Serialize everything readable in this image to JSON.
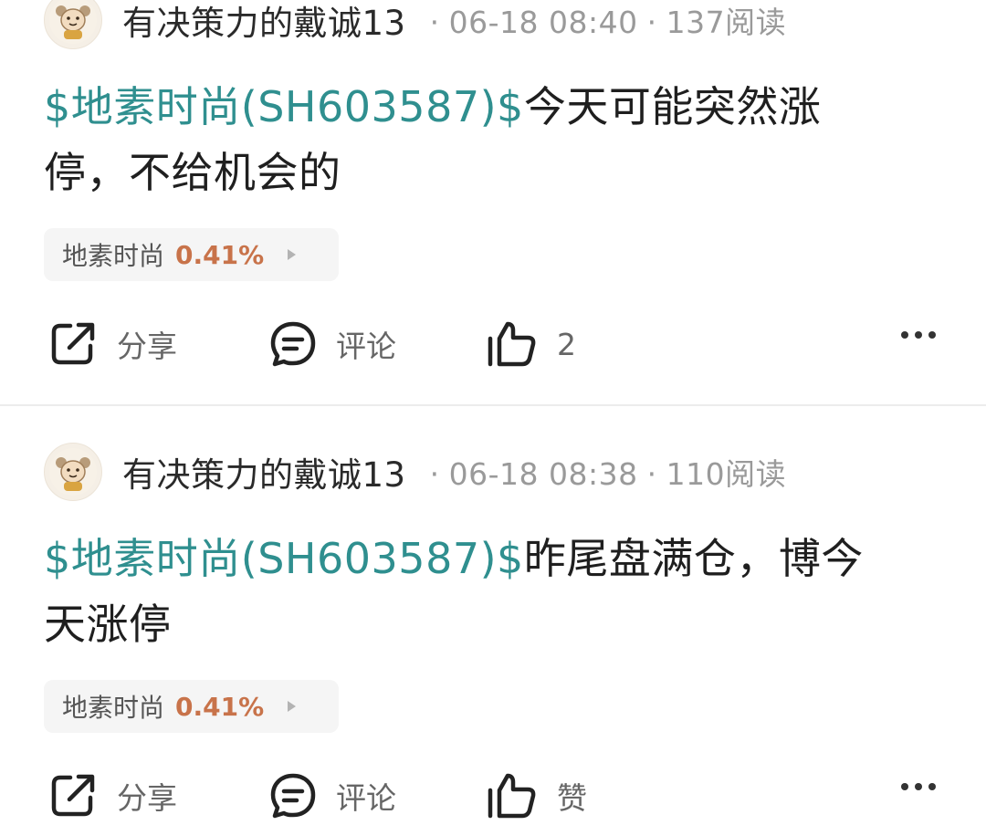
{
  "posts": [
    {
      "author": "有决策力的戴诚13",
      "time": "06-18 08:40",
      "reads": "137阅读",
      "stock_tag": "$地素时尚(SH603587)$",
      "body_line1": "今天可能突然涨",
      "body_line2": "停，不给机会的",
      "quote_name": "地素时尚",
      "quote_change": "0.41%",
      "share_label": "分享",
      "comment_label": "评论",
      "like_label": "2"
    },
    {
      "author": "有决策力的戴诚13",
      "time": "06-18 08:38",
      "reads": "110阅读",
      "stock_tag": "$地素时尚(SH603587)$",
      "body_line1": "昨尾盘满仓，博今",
      "body_line2": "天涨停",
      "quote_name": "地素时尚",
      "quote_change": "0.41%",
      "share_label": "分享",
      "comment_label": "评论",
      "like_label": "赞"
    }
  ],
  "separator": "·",
  "colors": {
    "link": "#2f8f8f",
    "change_up": "#c8734a",
    "muted": "#9a9a9a",
    "divider": "#ececec"
  },
  "icons": [
    "avatar-icon",
    "share-icon",
    "comment-icon",
    "like-icon",
    "more-icon"
  ]
}
